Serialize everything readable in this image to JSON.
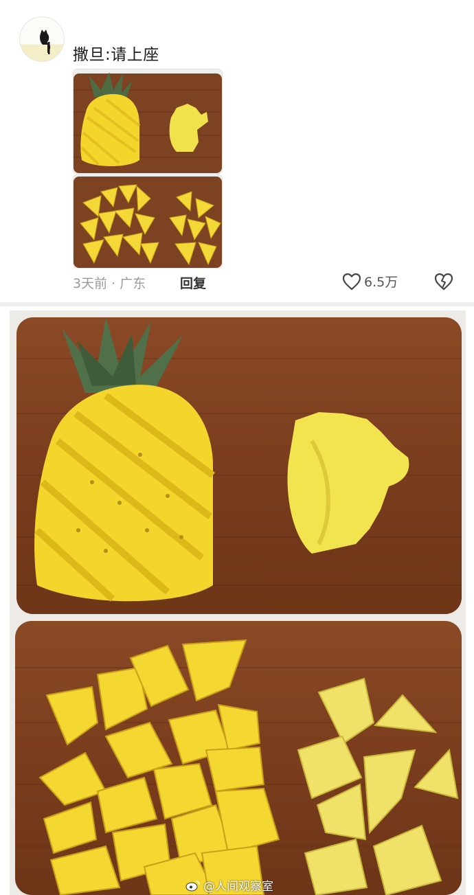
{
  "comment": {
    "username": "撒旦:请上座",
    "time_location": "3天前 · 广东",
    "reply_label": "回复",
    "like_count": "6.5万"
  },
  "icons": {
    "avatar": "black-cat-silhouette",
    "like": "heart-outline-icon",
    "dislike": "broken-heart-icon",
    "watermark": "weibo-icon"
  },
  "watermark": {
    "text": "@人间观察室"
  },
  "colors": {
    "board_wood": "#7a3e1e",
    "pineapple_flesh": "#f2d631",
    "pineapple_leaves": "#55714a",
    "meta_grey": "#9a9a9a"
  }
}
